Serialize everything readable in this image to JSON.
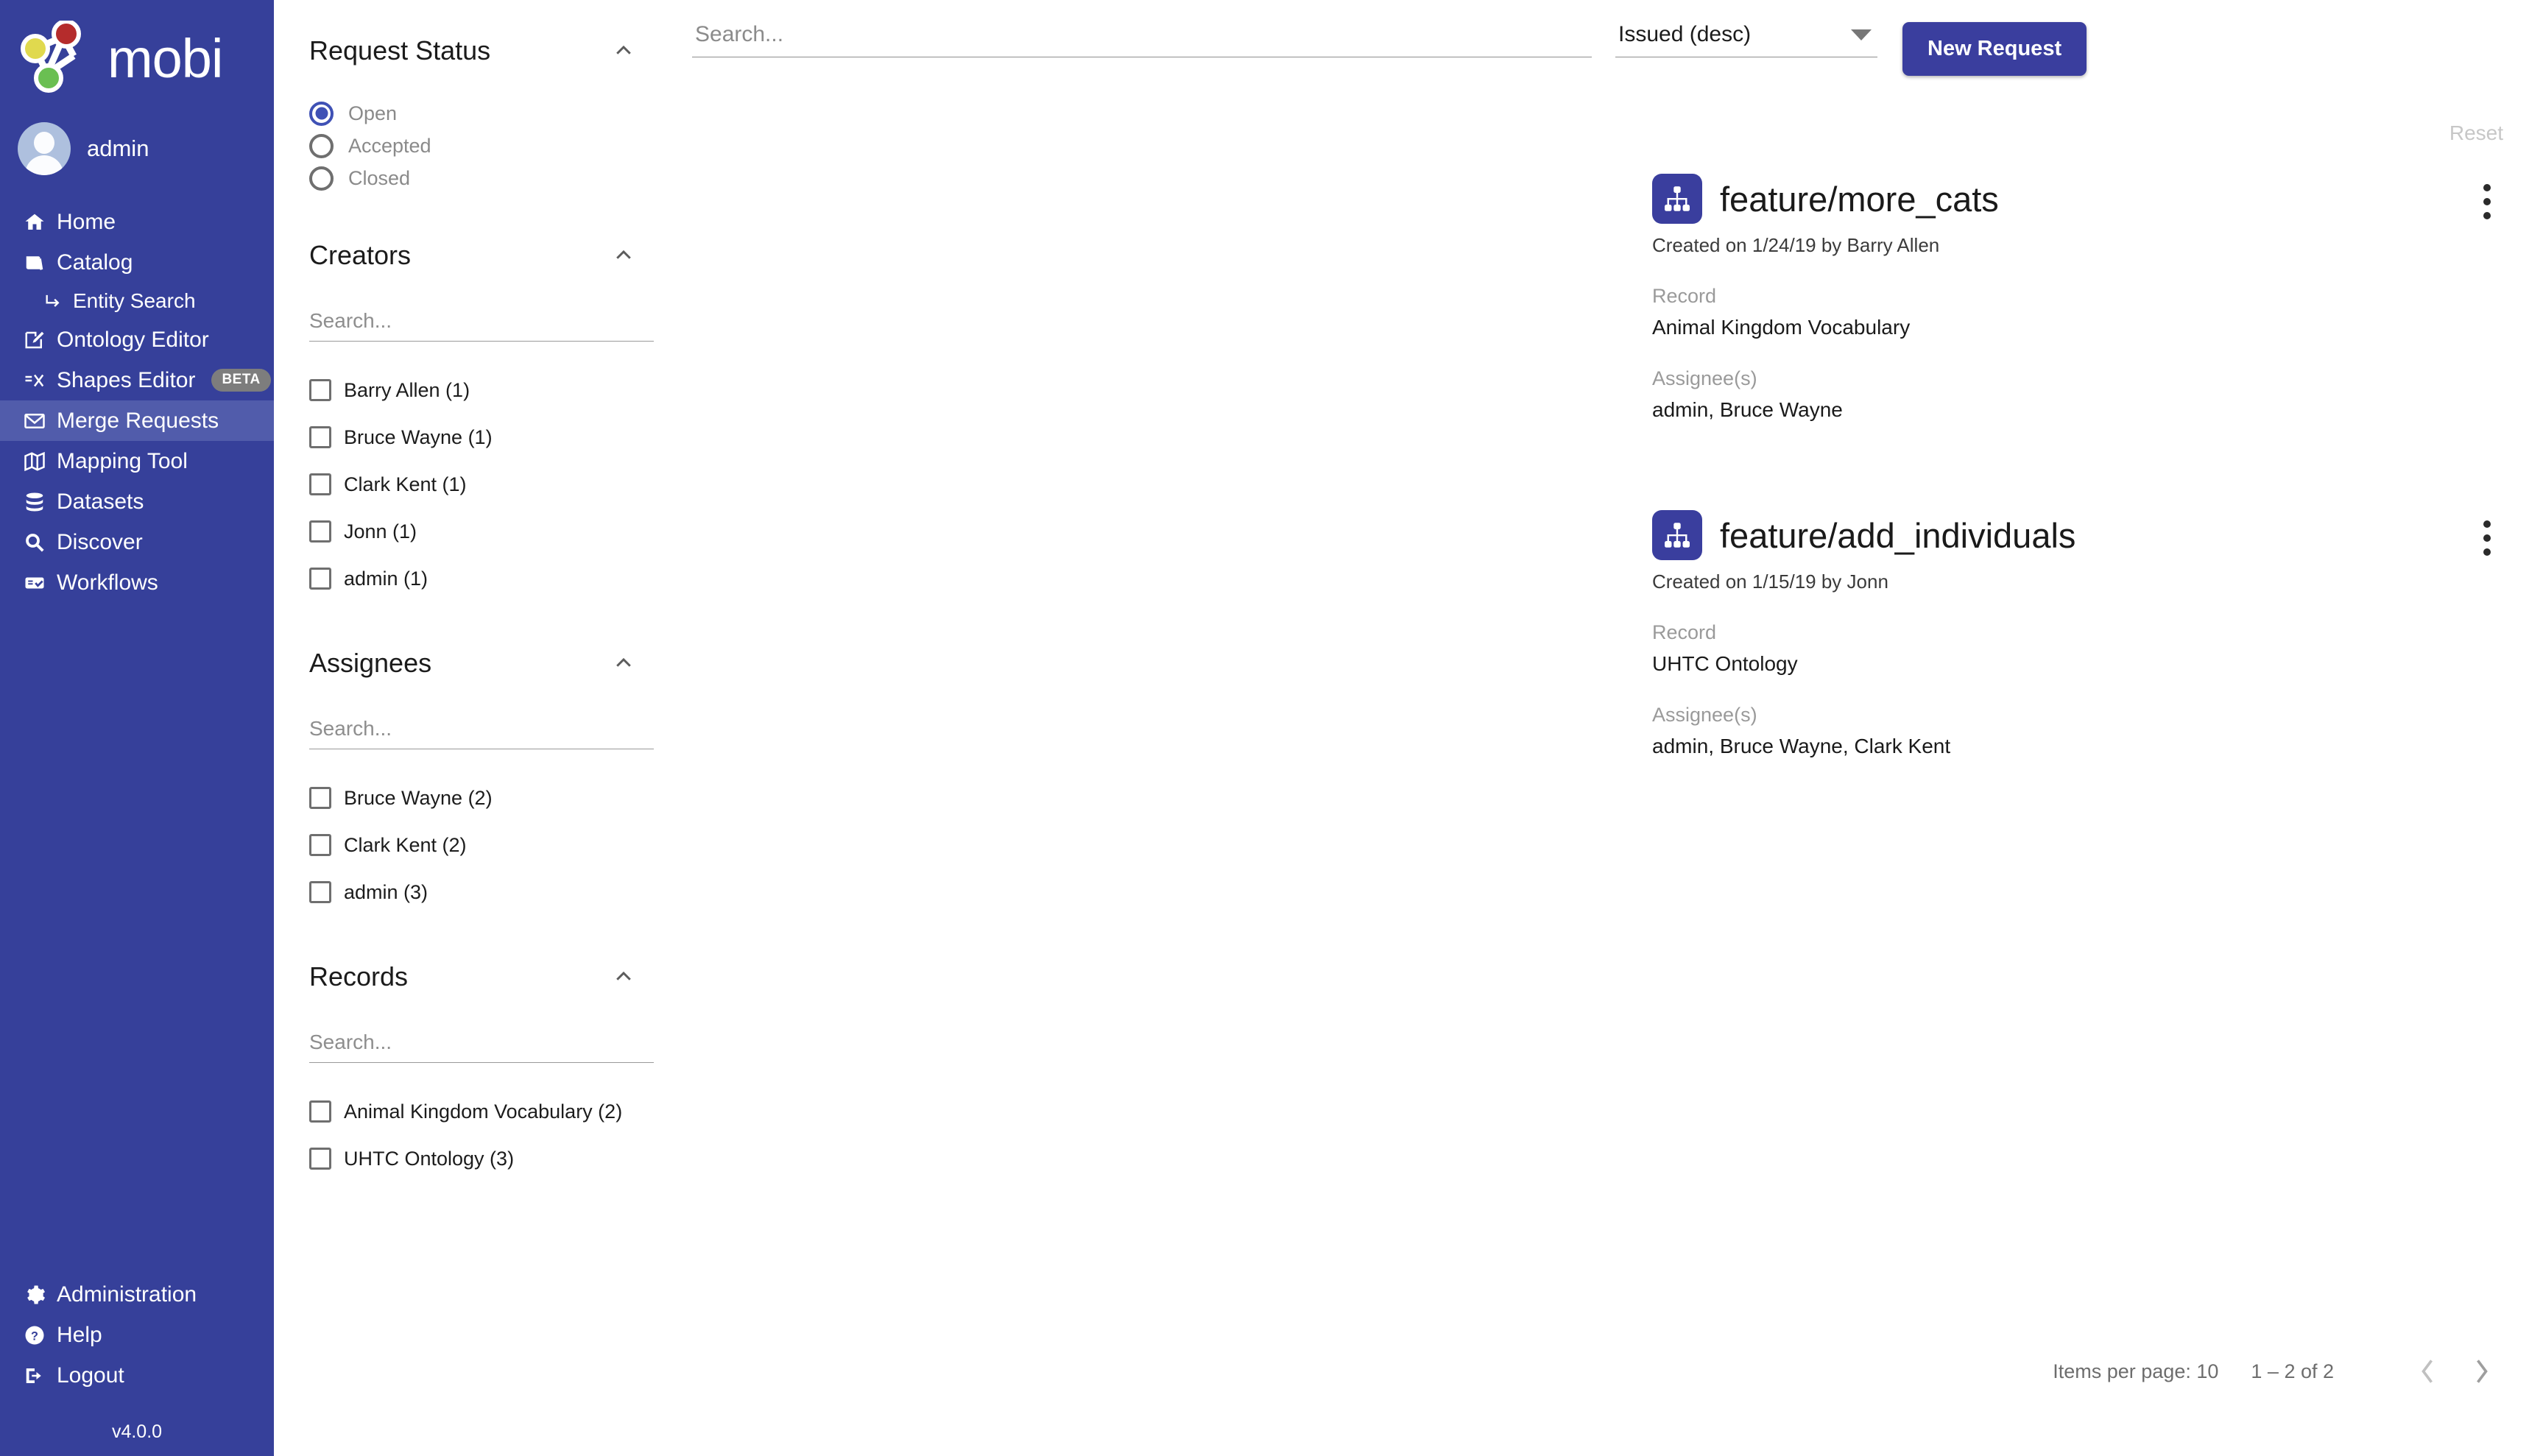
{
  "brand": {
    "name": "mobi",
    "version": "v4.0.0"
  },
  "user": {
    "name": "admin"
  },
  "sidebar": {
    "items": [
      {
        "label": "Home",
        "icon": "home-icon",
        "active": false
      },
      {
        "label": "Catalog",
        "icon": "book-icon",
        "active": false
      },
      {
        "label": "Entity Search",
        "icon": "arrow-turn-icon",
        "active": false,
        "sub": true
      },
      {
        "label": "Ontology Editor",
        "icon": "edit-square-icon",
        "active": false
      },
      {
        "label": "Shapes Editor",
        "icon": "shapes-icon",
        "active": false,
        "badge": "BETA"
      },
      {
        "label": "Merge Requests",
        "icon": "envelope-icon",
        "active": true
      },
      {
        "label": "Mapping Tool",
        "icon": "map-icon",
        "active": false
      },
      {
        "label": "Datasets",
        "icon": "database-icon",
        "active": false
      },
      {
        "label": "Discover",
        "icon": "magnifier-icon",
        "active": false
      },
      {
        "label": "Workflows",
        "icon": "workflow-icon",
        "active": false
      }
    ],
    "bottom_items": [
      {
        "label": "Administration",
        "icon": "gear-icon"
      },
      {
        "label": "Help",
        "icon": "question-circle-icon"
      },
      {
        "label": "Logout",
        "icon": "logout-icon"
      }
    ]
  },
  "filters": {
    "request_status": {
      "title": "Request Status",
      "collapse_icon": "chevron-up-icon",
      "options": [
        {
          "label": "Open",
          "selected": true
        },
        {
          "label": "Accepted",
          "selected": false
        },
        {
          "label": "Closed",
          "selected": false
        }
      ]
    },
    "creators": {
      "title": "Creators",
      "collapse_icon": "chevron-up-icon",
      "search_placeholder": "Search...",
      "search_value": "",
      "options": [
        {
          "label": "Barry Allen (1)",
          "checked": false
        },
        {
          "label": "Bruce Wayne (1)",
          "checked": false
        },
        {
          "label": "Clark Kent (1)",
          "checked": false
        },
        {
          "label": "Jonn (1)",
          "checked": false
        },
        {
          "label": "admin (1)",
          "checked": false
        }
      ]
    },
    "assignees": {
      "title": "Assignees",
      "collapse_icon": "chevron-up-icon",
      "search_placeholder": "Search...",
      "search_value": "",
      "options": [
        {
          "label": "Bruce Wayne (2)",
          "checked": false
        },
        {
          "label": "Clark Kent (2)",
          "checked": false
        },
        {
          "label": "admin (3)",
          "checked": false
        }
      ]
    },
    "records": {
      "title": "Records",
      "collapse_icon": "chevron-up-icon",
      "search_placeholder": "Search...",
      "search_value": "",
      "options": [
        {
          "label": "Animal Kingdom Vocabulary (2)",
          "checked": false
        },
        {
          "label": "UHTC Ontology (3)",
          "checked": false
        }
      ]
    }
  },
  "toolbar": {
    "search_placeholder": "Search...",
    "search_value": "",
    "sort_value": "Issued (desc)",
    "sort_caret_icon": "chevron-down-icon",
    "new_request_label": "New Request",
    "reset_label": "Reset"
  },
  "merge_requests": {
    "record_label": "Record",
    "assignees_label": "Assignee(s)",
    "menu_icon": "kebab-menu-icon",
    "branch_icon": "sitemap-icon",
    "items": [
      {
        "title": "feature/more_cats",
        "created": "Created on 1/24/19 by Barry Allen",
        "record": "Animal Kingdom Vocabulary",
        "assignees": "admin, Bruce Wayne"
      },
      {
        "title": "feature/add_individuals",
        "created": "Created on 1/15/19 by Jonn",
        "record": "UHTC Ontology",
        "assignees": "admin, Bruce Wayne, Clark Kent"
      }
    ]
  },
  "paginator": {
    "items_per_page_label": "Items per page:",
    "items_per_page_value": "10",
    "range_label": "1 – 2 of 2",
    "prev_icon": "chevron-left-icon",
    "next_icon": "chevron-right-icon"
  },
  "colors": {
    "sidebar_bg": "#36409A",
    "sidebar_active": "#515CAB",
    "accent": "#3A3E9E",
    "radio_selected": "#3F51B5"
  }
}
